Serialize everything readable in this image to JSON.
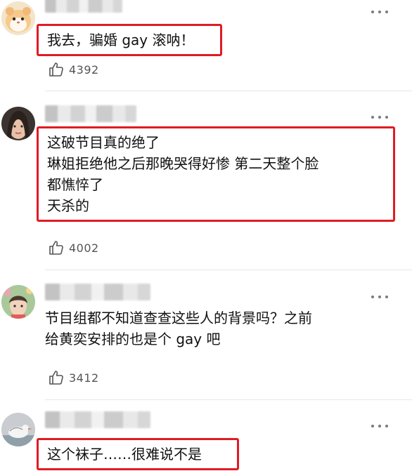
{
  "comments": [
    {
      "lines": [
        "我去，骗婚 gay 滚呐！"
      ],
      "likes": "4392",
      "highlighted": true
    },
    {
      "lines": [
        "这破节目真的绝了",
        "琳姐拒绝他之后那晚哭得好惨 第二天整个脸",
        "都憔悴了",
        "天杀的"
      ],
      "likes": "4002",
      "highlighted": true
    },
    {
      "lines": [
        "节目组都不知道查查这些人的背景吗？之前",
        "给黄奕安排的也是个 gay 吧"
      ],
      "likes": "3412",
      "highlighted": false
    },
    {
      "lines": [
        "这个袜子……很难说不是"
      ],
      "likes": "",
      "highlighted": true
    }
  ],
  "colors": {
    "highlight_border": "#e01b24",
    "text": "#111111",
    "meta": "#555555",
    "icon": "#7a7a7a"
  },
  "icons": {
    "like": "thumbs-up-icon",
    "more": "more-dots-icon"
  }
}
